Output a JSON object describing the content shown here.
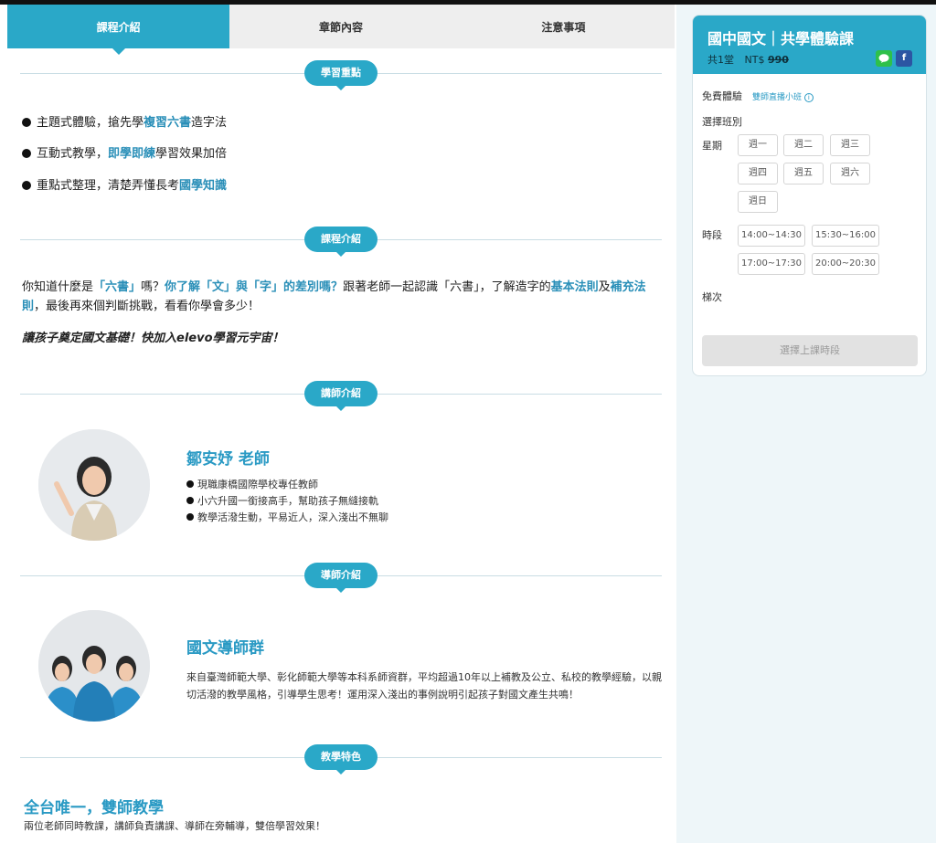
{
  "tabs": [
    "課程介紹",
    "章節內容",
    "注意事項"
  ],
  "sections": {
    "highlights": "學習重點",
    "intro": "課程介紹",
    "teacher": "講師介紹",
    "tutor": "導師介紹",
    "features": "教學特色"
  },
  "highlights": [
    {
      "a": "主題式體驗，搶先學",
      "b": "複習六書",
      "c": "造字法"
    },
    {
      "a": "互動式教學，",
      "b": "即學即練",
      "c": "學習效果加倍"
    },
    {
      "a": "重點式整理，清楚弄懂長考",
      "b": "國學知識",
      "c": ""
    }
  ],
  "intro": {
    "p1_parts": [
      "你知道什麼是",
      "「六書」",
      "嗎？",
      "你了解「文」與「字」的差別嗎？",
      "跟著老師一起認識「六書」，了解造字的",
      "基本法則",
      "及",
      "補充法則",
      "，最後再來個判斷挑戰，看看你學會多少！"
    ],
    "p2": "讓孩子奠定國文基礎！快加入elevo學習元宇宙！"
  },
  "teacher": {
    "name": "鄒安妤 老師",
    "points": [
      "現職康橋國際學校專任教師",
      "小六升國一銜接高手，幫助孩子無縫接軌",
      "教學活潑生動，平易近人，深入淺出不無聊"
    ]
  },
  "tutor": {
    "name": "國文導師群",
    "desc": "來自臺灣師範大學、彰化師範大學等本科系師資群，平均超過10年以上補教及公立、私校的教學經驗，以親切活潑的教學風格，引導學生思考！運用深入淺出的事例說明引起孩子對國文產生共鳴！"
  },
  "features": {
    "title": "全台唯一，雙師教學",
    "desc": "兩位老師同時教課，講師負責講課、導師在旁輔導，雙倍學習效果！"
  },
  "card": {
    "title": "國中國文｜共學體驗課",
    "sessions": "共1堂",
    "currency": "NT$",
    "price": "990",
    "line_icon": "line-icon",
    "fb_icon": "facebook-icon",
    "free_label": "免費體驗",
    "free_link": "雙師直播小班",
    "choose_class": "選擇班別",
    "weekday_label": "星期",
    "weekdays": [
      "週一",
      "週二",
      "週三",
      "週四",
      "週五",
      "週六",
      "週日"
    ],
    "time_label": "時段",
    "times": [
      "14:00~14:30",
      "15:30~16:00",
      "17:00~17:30",
      "20:00~20:30"
    ],
    "batch_label": "梯次",
    "submit": "選擇上課時段"
  },
  "colors": {
    "accent": "#2aa8c8",
    "highlight": "#2a8fb8"
  }
}
